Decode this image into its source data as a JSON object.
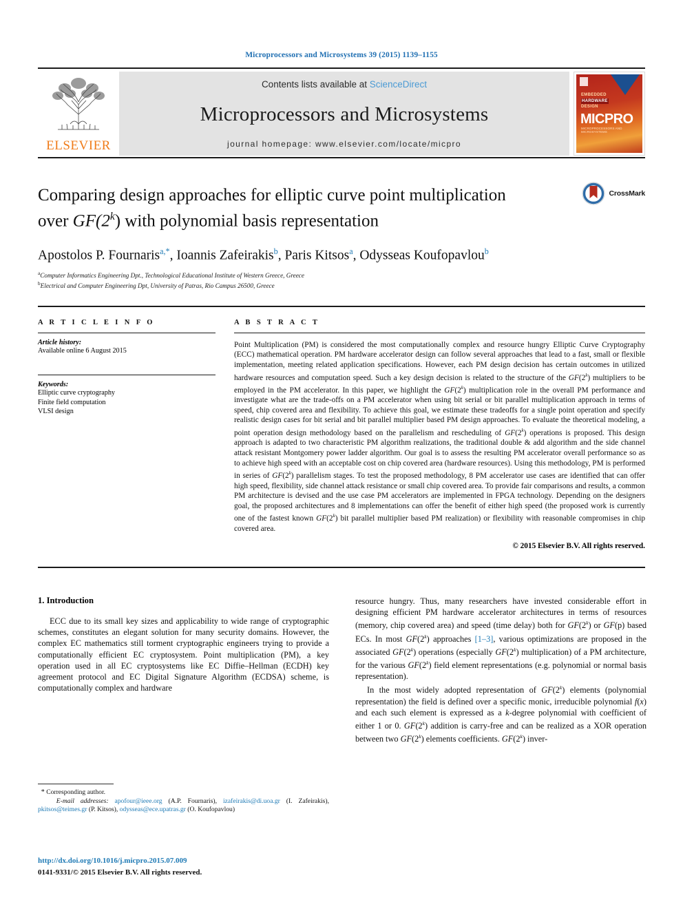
{
  "running_head": "Microprocessors and Microsystems 39 (2015) 1139–1155",
  "masthead": {
    "contents_prefix": "Contents lists available at ",
    "sciencedirect": "ScienceDirect",
    "journal_title": "Microprocessors and Microsystems",
    "homepage": "journal homepage: www.elsevier.com/locate/micpro",
    "publisher": "ELSEVIER",
    "cover": {
      "kicker_line1": "EMBEDDED",
      "kicker_line2": "HARDWARE",
      "kicker_line3": "DESIGN",
      "title": "MICPRO",
      "subtitle": "MICROPROCESSORS AND MICROSYSTEMS"
    },
    "accent_blue": "#4a9ad4",
    "accent_orange": "#f07c1a"
  },
  "article": {
    "title_line1": "Comparing design approaches for elliptic curve point multiplication",
    "title_line2_pre": "over ",
    "title_gf": "GF",
    "title_2": "(2",
    "title_k": "k",
    "title_line2_post": ") with polynomial basis representation",
    "authors": [
      {
        "name": "Apostolos P. Fournaris",
        "marks": "a,*"
      },
      {
        "name": "Ioannis Zafeirakis",
        "marks": "b"
      },
      {
        "name": "Paris Kitsos",
        "marks": "a"
      },
      {
        "name": "Odysseas Koufopavlou",
        "marks": "b"
      }
    ],
    "affiliations": [
      {
        "mark": "a",
        "text": "Computer Informatics Engineering Dpt., Technological Educational Institute of Western Greece, Greece"
      },
      {
        "mark": "b",
        "text": "Electrical and Computer Engineering Dpt, University of Patras, Rio Campus 26500, Greece"
      }
    ],
    "crossmark_label": "CrossMark"
  },
  "article_info": {
    "heading": "A R T I C L E   I N F O",
    "history_label": "Article history:",
    "history_value": "Available online 6 August 2015",
    "keywords_label": "Keywords:",
    "keywords": [
      "Elliptic curve cryptography",
      "Finite field computation",
      "VLSI design"
    ]
  },
  "abstract": {
    "heading": "A B S T R A C T",
    "paragraphs": [
      "Point Multiplication (PM) is considered the most computationally complex and resource hungry Elliptic Curve Cryptography (ECC) mathematical operation. PM hardware accelerator design can follow several approaches that lead to a fast, small or flexible implementation, meeting related application specifications. However, each PM design decision has certain outcomes in utilized hardware resources and computation speed. Such a key design decision is related to the structure of the GF(2k) multipliers to be employed in the PM accelerator. In this paper, we highlight the GF(2k) multiplication role in the overall PM performance and investigate what are the trade-offs on a PM accelerator when using bit serial or bit parallel multiplication approach in terms of speed, chip covered area and flexibility. To achieve this goal, we estimate these tradeoffs for a single point operation and specify realistic design cases for bit serial and bit parallel multiplier based PM design approaches. To evaluate the theoretical modeling, a point operation design methodology based on the parallelism and rescheduling of GF(2k) operations is proposed. This design approach is adapted to two characteristic PM algorithm realizations, the traditional double & add algorithm and the side channel attack resistant Montgomery power ladder algorithm. Our goal is to assess the resulting PM accelerator overall performance so as to achieve high speed with an acceptable cost on chip covered area (hardware resources). Using this methodology, PM is performed in series of GF(2k) parallelism stages. To test the proposed methodology, 8 PM accelerator use cases are identified that can offer high speed, flexibility, side channel attack resistance or small chip covered area. To provide fair comparisons and results, a common PM architecture is devised and the use case PM accelerators are implemented in FPGA technology. Depending on the designers goal, the proposed architectures and 8 implementations can offer the benefit of either high speed (the proposed work is currently one of the fastest known GF(2k) bit parallel multiplier based PM realization) or flexibility with reasonable compromises in chip covered area."
    ],
    "copyright": "© 2015 Elsevier B.V. All rights reserved."
  },
  "introduction": {
    "heading": "1. Introduction",
    "left_paragraph": "ECC due to its small key sizes and applicability to wide range of cryptographic schemes, constitutes an elegant solution for many security domains. However, the complex EC mathematics still torment cryptographic engineers trying to provide a computationally efficient EC cryptosystem. Point multiplication (PM), a key operation used in all EC cryptosystems like EC Diffie–Hellman (ECDH) key agreement protocol and EC Digital Signature Algorithm (ECDSA) scheme, is computationally complex and hardware",
    "right_paragraph_1": "resource hungry. Thus, many researchers have invested considerable effort in designing efficient PM hardware accelerator architectures in terms of resources (memory, chip covered area) and speed (time delay) both for GF(2k) or GF(p) based ECs. In most GF(2k) approaches [1–3], various optimizations are proposed in the associated GF(2k) operations (especially GF(2k) multiplication) of a PM architecture, for the various GF(2k) field element representations (e.g. polynomial or normal basis representation).",
    "right_paragraph_2": "In the most widely adopted representation of GF(2k) elements (polynomial representation) the field is defined over a specific monic, irreducible polynomial f(x) and each such element is expressed as a k-degree polynomial with coefficient of either 1 or 0. GF(2k) addition is carry-free and can be realized as a XOR operation between two GF(2k) elements coefficients. GF(2k) inver-",
    "citation_label": "[1–3]"
  },
  "footnotes": {
    "corresponding_star": "*",
    "corresponding_text": "Corresponding author.",
    "email_label": "E-mail addresses:",
    "emails": [
      {
        "address": "apofour@ieee.org",
        "owner": "(A.P. Fournaris)"
      },
      {
        "address": "izafeirakis@di.uoa.gr",
        "owner": "(I. Zafeirakis)"
      },
      {
        "address": "pkitsos@teimes.gr",
        "owner": "(P. Kitsos)"
      },
      {
        "address": "odysseas@ece.upatras.gr",
        "owner": "(O. Koufopavlou)"
      }
    ],
    "doi": "http://dx.doi.org/10.1016/j.micpro.2015.07.009",
    "issn_line": "0141-9331/© 2015 Elsevier B.V. All rights reserved."
  }
}
